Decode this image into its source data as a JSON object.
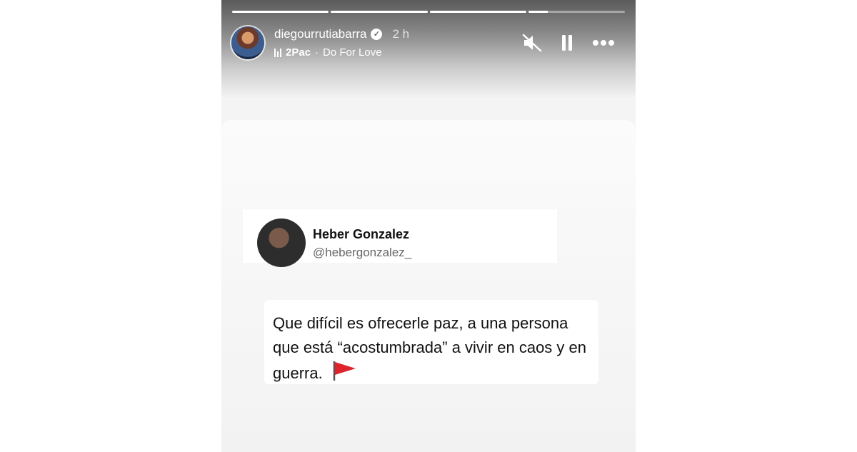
{
  "story": {
    "username": "diegourrutiabarra",
    "time": "2 h",
    "music": {
      "artist": "2Pac",
      "separator": "·",
      "song": "Do For Love"
    },
    "progress": [
      1,
      1,
      1,
      0.2
    ],
    "controls": {
      "mute_icon": "muted-speaker-icon",
      "pause_icon": "pause-icon",
      "more_icon": "more-options-icon"
    }
  },
  "tweet": {
    "name": "Heber Gonzalez",
    "handle": "@hebergonzalez_",
    "text": "Que difícil es ofrecerle paz, a una persona que está “acostumbrada” a vivir en caos y en guerra.",
    "emoji_icon": "red-flag-icon"
  },
  "colors": {
    "header_dark": "#5a5a5a",
    "text": "#111111",
    "handle": "#666666",
    "flag": "#e0242e"
  }
}
